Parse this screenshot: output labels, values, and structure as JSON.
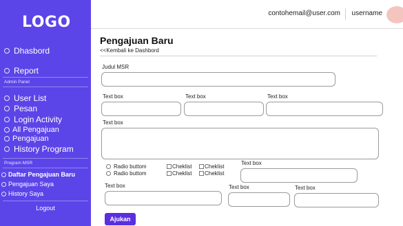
{
  "sidebar": {
    "logo": "LOGO",
    "items_main": [
      {
        "label": "Dhasbord"
      },
      {
        "label": "Report"
      }
    ],
    "admin_section_label": "Admin Panel",
    "items_admin": [
      {
        "label": "User List"
      },
      {
        "label": "Pesan"
      },
      {
        "label": "Login Activity"
      },
      {
        "label": "All Pengajuan"
      },
      {
        "label": "Pengajuan"
      },
      {
        "label": "History Program"
      }
    ],
    "msr_section_label": "Program MSR",
    "items_msr": [
      {
        "label": "Daftar Pengajuan Baru"
      },
      {
        "label": "Pengajuan Saya"
      },
      {
        "label": "History Saya"
      }
    ],
    "logout": "Logout"
  },
  "header": {
    "email": "contohemail@user.com",
    "username": "username"
  },
  "main": {
    "title": "Pengajuan Baru",
    "back_link": "<<Kembali ke Dashbord",
    "judul_label": "Judul MSR",
    "text_box_label": "Text box",
    "radio_label": "Radio buttom",
    "checklist_label": "Cheklist",
    "submit_label": "Ajukan"
  },
  "colors": {
    "sidebar_bg": "#5b45e8",
    "button_bg": "#5b2ee0",
    "avatar": "#f4c4bf"
  }
}
